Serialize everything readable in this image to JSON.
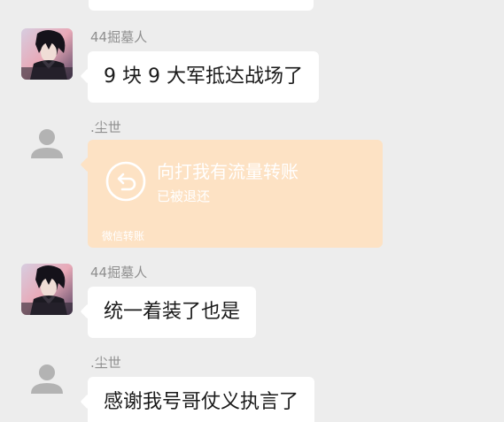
{
  "messages": [
    {
      "sender": "44掘墓人",
      "text": "9 块 9 大军抵达战场了"
    },
    {
      "sender": ".尘世",
      "transfer": {
        "title": "向打我有流量转账",
        "status": "已被退还",
        "footer": "微信转账"
      }
    },
    {
      "sender": "44掘墓人",
      "text": "统一着装了也是"
    },
    {
      "sender": ".尘世",
      "text": "感谢我号哥仗义执言了"
    }
  ],
  "colors": {
    "background": "#ededed",
    "bubble": "#ffffff",
    "transfer_card": "#fde2c4",
    "sender_name": "#8f8f8f"
  },
  "icons": {
    "anime_avatar": "anime-character-avatar",
    "default_avatar": "default-user-avatar",
    "transfer_return": "return-arrow-icon"
  }
}
